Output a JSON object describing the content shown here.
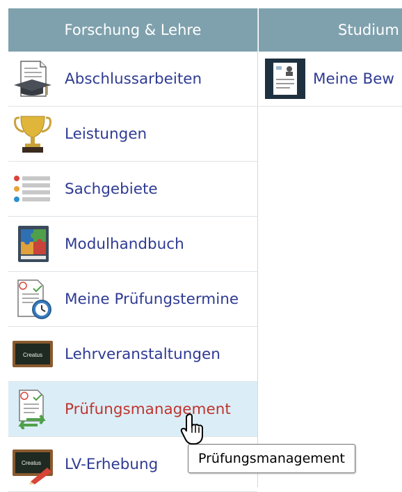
{
  "columns": [
    {
      "header": "Forschung & Lehre",
      "items": [
        {
          "label": "Abschlussarbeiten",
          "icon": "thesis-graduation-cap-icon"
        },
        {
          "label": "Leistungen",
          "icon": "trophy-icon"
        },
        {
          "label": "Sachgebiete",
          "icon": "category-list-icon"
        },
        {
          "label": "Modulhandbuch",
          "icon": "puzzle-book-icon"
        },
        {
          "label": "Meine Prüfungstermine",
          "icon": "exam-clock-icon"
        },
        {
          "label": "Lehrveranstaltungen",
          "icon": "chalkboard-icon"
        },
        {
          "label": "Prüfungsmanagement",
          "icon": "exam-management-icon"
        },
        {
          "label": "LV-Erhebung",
          "icon": "chalkboard-pencil-icon"
        }
      ]
    },
    {
      "header": "Studium",
      "items": [
        {
          "label": "Meine Bew",
          "icon": "application-document-icon"
        }
      ]
    }
  ],
  "chalkboard_text": "Сreatus",
  "tooltip": "Prüfungsmanagement",
  "hovered_item": "Prüfungsmanagement",
  "colors": {
    "header_bg": "#7fa1ad",
    "link": "#2f3b93",
    "link_hover": "#c0342e",
    "hover_row": "#dbeef7"
  },
  "cursor": "hand-pointer-icon"
}
